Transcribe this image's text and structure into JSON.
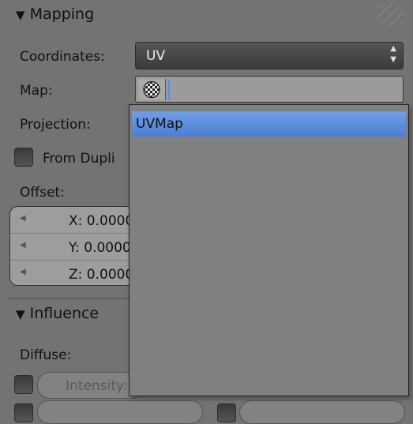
{
  "mapping": {
    "title": "Mapping",
    "coordinates_label": "Coordinates:",
    "coordinates_value": "UV",
    "map_label": "Map:",
    "map_value": "",
    "projection_label": "Projection:",
    "from_dupli_label": "From Dupli",
    "from_dupli_checked": false,
    "offset_label": "Offset:",
    "offset": [
      {
        "axis": "X:",
        "text": "X: 0.0000"
      },
      {
        "axis": "Y:",
        "text": "Y: 0.0000"
      },
      {
        "axis": "Z:",
        "text": "Z: 0.0000"
      }
    ]
  },
  "influence": {
    "title": "Influence",
    "diffuse_label": "Diffuse:",
    "intensity_label": "Intensity:"
  },
  "popup": {
    "items": [
      "UVMap"
    ],
    "selected_index": 0
  },
  "colors": {
    "background": "#737373",
    "highlight": "#5a8ddc",
    "cursor": "#4a90e8"
  },
  "icons": {
    "collapse": "triangle-down-icon",
    "dropdown": "up-down-arrows-icon",
    "map_icon": "checker-sphere-icon",
    "grip": "resize-grip-icon",
    "decrement": "left-arrow-icon"
  }
}
